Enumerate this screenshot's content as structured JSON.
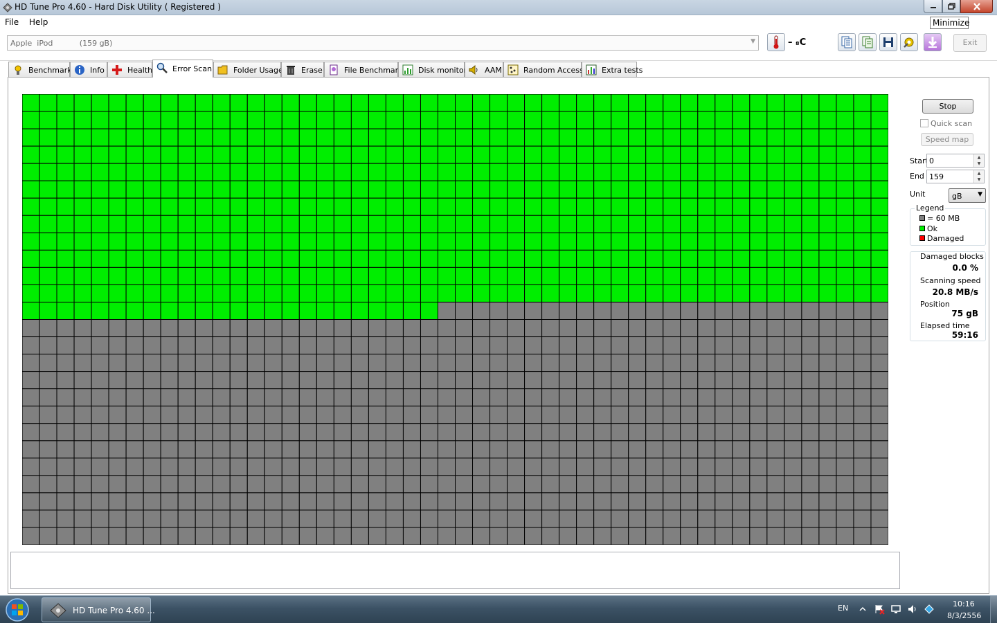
{
  "window": {
    "title": "HD Tune Pro 4.60 - Hard Disk Utility ( Registered )"
  },
  "menu": {
    "file": "File",
    "help": "Help"
  },
  "tooltip": {
    "text": "Minimize"
  },
  "toolbar": {
    "drive": "Apple  iPod           (159 gB)",
    "temperature": "– ₈C",
    "exit_label": "Exit"
  },
  "tabs": [
    {
      "label": "Benchmark",
      "icon": "benchmark-icon"
    },
    {
      "label": "Info",
      "icon": "info-icon"
    },
    {
      "label": "Health",
      "icon": "health-icon"
    },
    {
      "label": "Error Scan",
      "icon": "magnifier-icon",
      "active": true
    },
    {
      "label": "Folder Usage",
      "icon": "folder-icon"
    },
    {
      "label": "Erase",
      "icon": "trash-icon"
    },
    {
      "label": "File Benchmark",
      "icon": "file-benchmark-icon"
    },
    {
      "label": "Disk monitor",
      "icon": "chart-icon"
    },
    {
      "label": "AAM",
      "icon": "speaker-icon"
    },
    {
      "label": "Random Access",
      "icon": "random-access-icon"
    },
    {
      "label": "Extra tests",
      "icon": "extra-tests-icon"
    }
  ],
  "scan": {
    "columns": 50,
    "rows": 26,
    "ok_blocks_full_rows": 12,
    "ok_blocks_partial_row": 24,
    "colors": {
      "ok": "#00ee00",
      "pending": "#808080",
      "damaged": "#ff0000",
      "grid_line": "#000000"
    }
  },
  "controls": {
    "stop_label": "Stop",
    "quick_scan_label": "Quick scan",
    "speed_map_label": "Speed map",
    "start_label": "Start",
    "start_value": "0",
    "end_label": "End",
    "end_value": "159",
    "unit_label": "Unit",
    "unit_value": "gB"
  },
  "legend": {
    "title": "Legend",
    "items": [
      {
        "label": "= 60 MB",
        "color": "#808080"
      },
      {
        "label": "Ok",
        "color": "#00ee00"
      },
      {
        "label": "Damaged",
        "color": "#ff0000"
      }
    ]
  },
  "stats": {
    "damaged_label": "Damaged blocks",
    "damaged_value": "0.0 %",
    "speed_label": "Scanning speed",
    "speed_value": "20.8 MB/s",
    "position_label": "Position",
    "position_value": "75 gB",
    "elapsed_label": "Elapsed time",
    "elapsed_value": "59:16"
  },
  "taskbar": {
    "task_label": "HD Tune Pro 4.60 ...",
    "language": "EN",
    "time": "10:16",
    "date": "8/3/2556"
  }
}
